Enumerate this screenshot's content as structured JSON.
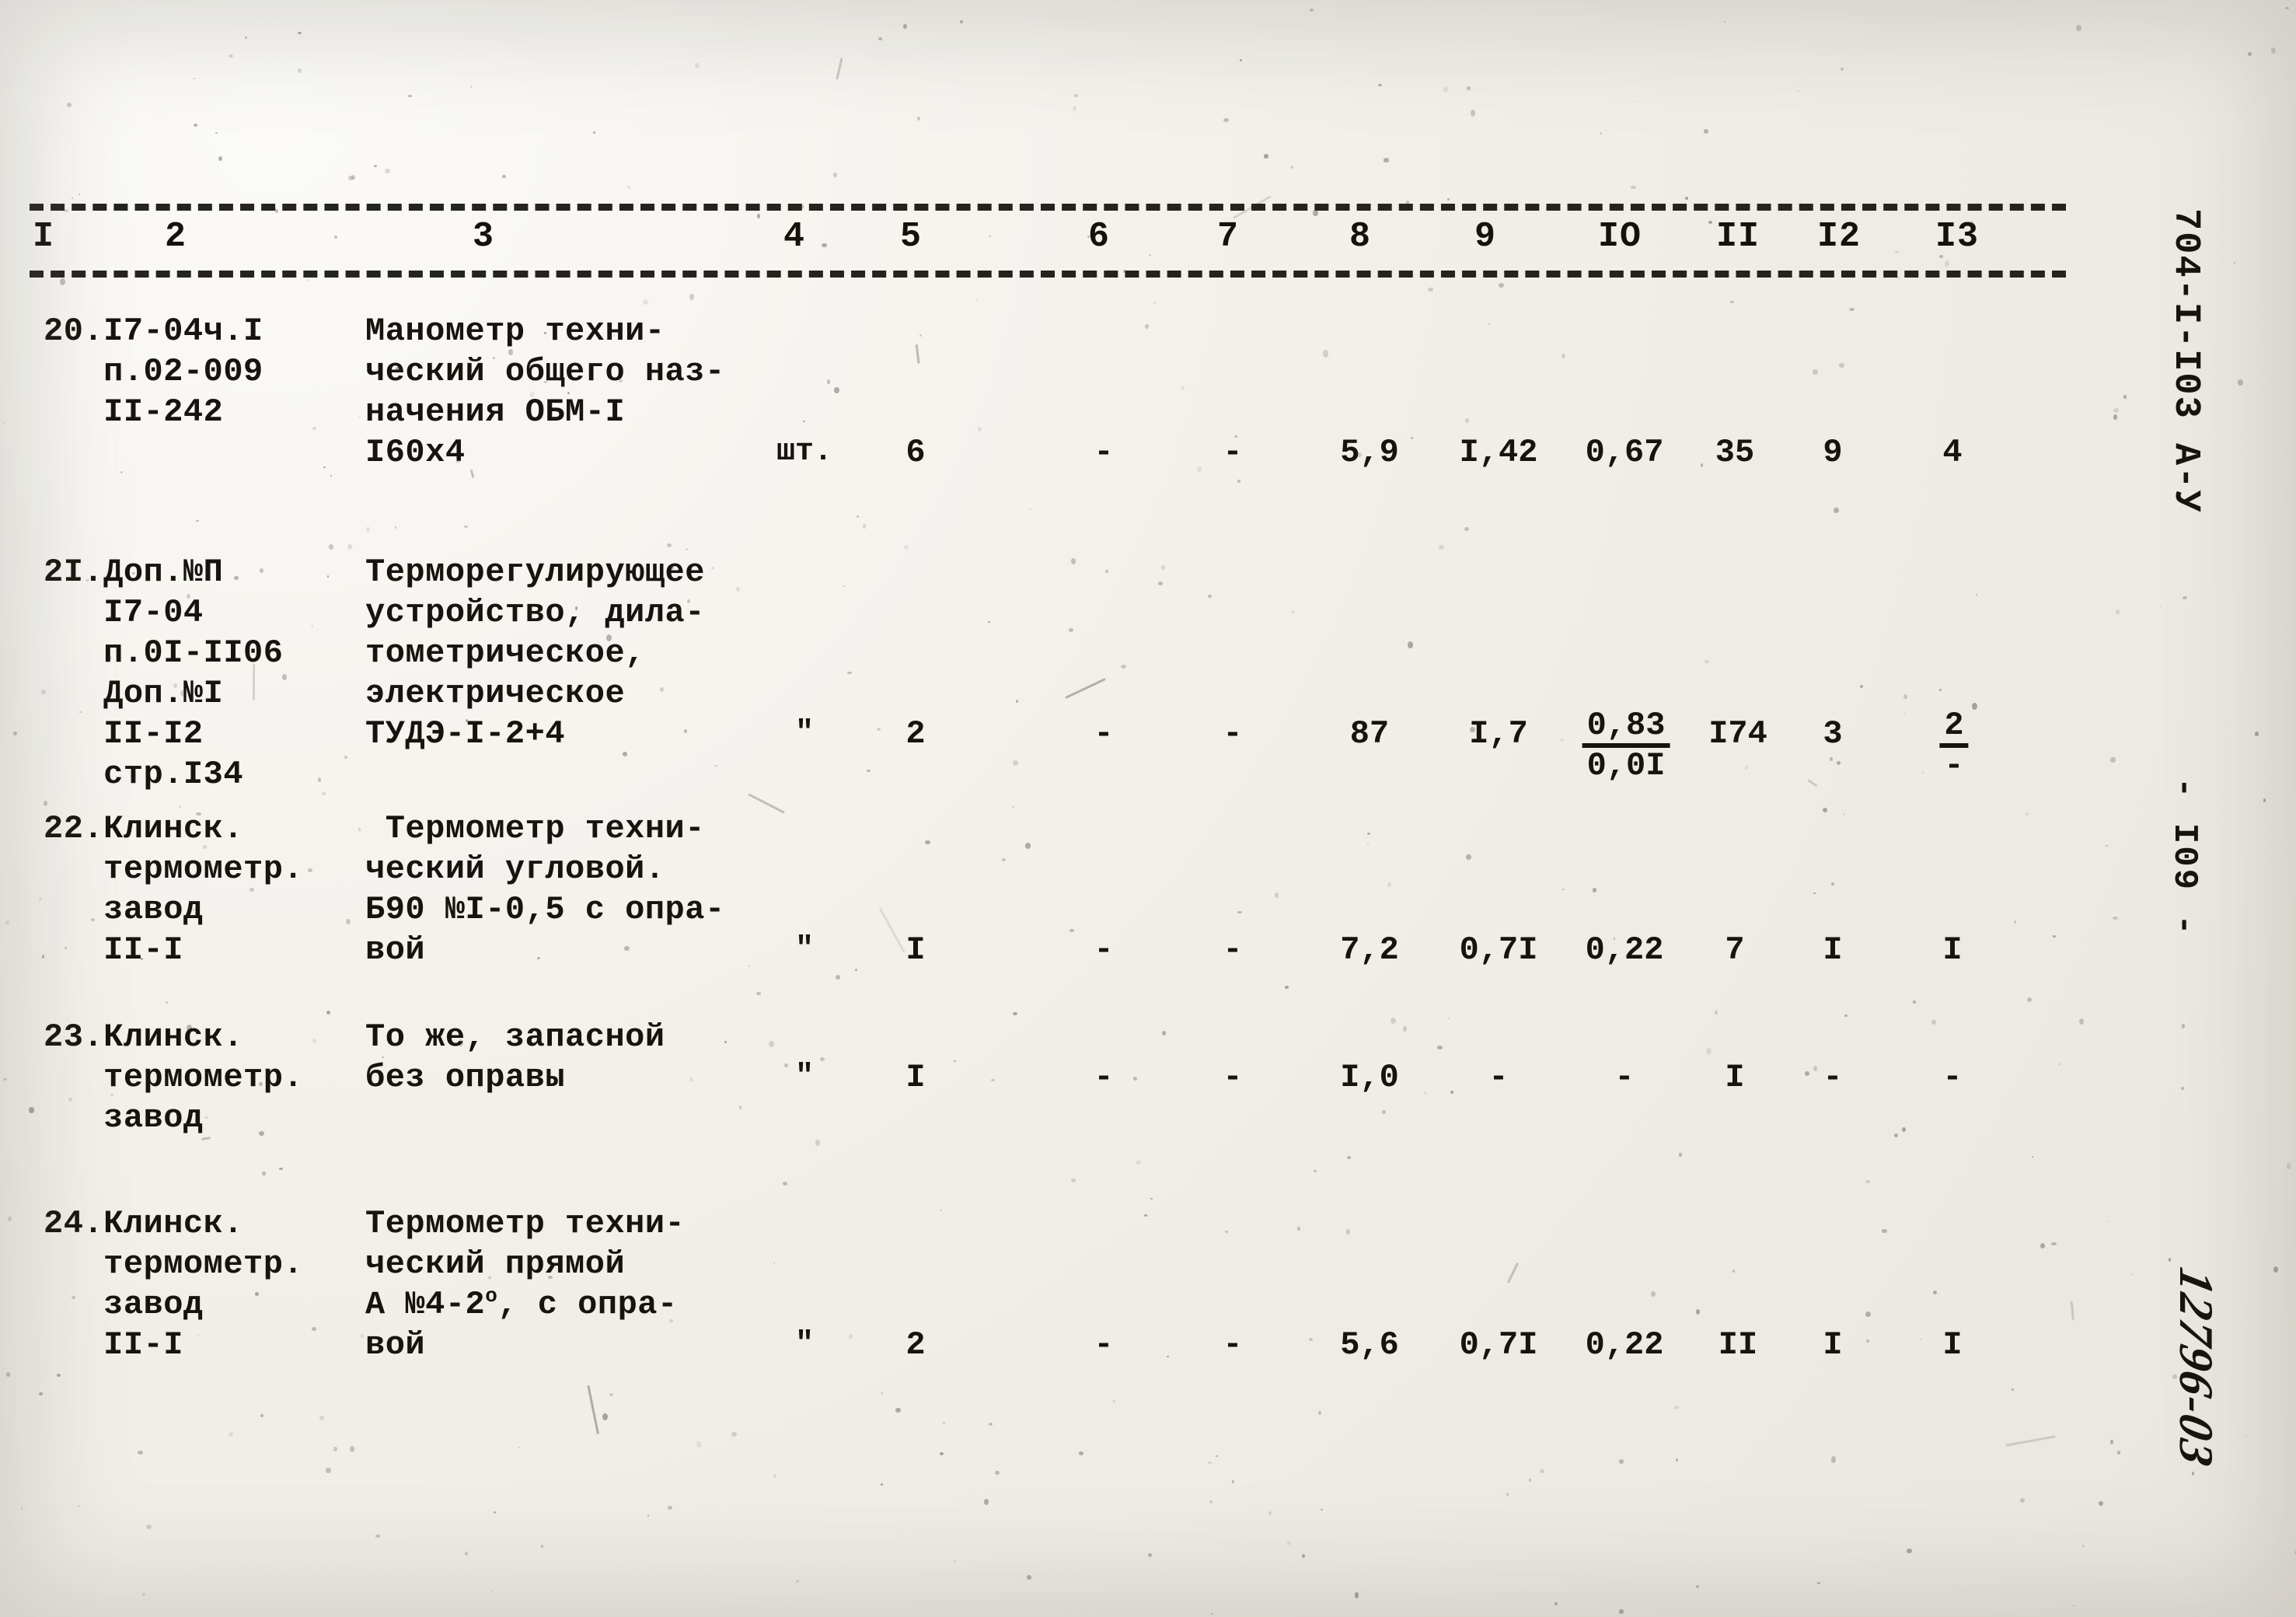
{
  "document": {
    "doc_code": "704-I-I03 А-У",
    "page_number": "- I09 -",
    "archive_number": "12796-03"
  },
  "table": {
    "column_headers": [
      "I",
      "2",
      "3",
      "4",
      "5",
      "6",
      "7",
      "8",
      "9",
      "IO",
      "II",
      "I2",
      "I3"
    ],
    "rows": [
      {
        "code_lines": [
          "20.I7-04ч.I",
          "   п.02-009",
          "   II-242"
        ],
        "desc_lines": [
          "Манометр техни-",
          "ческий общего наз-",
          "начения ОБМ-I",
          "I60х4"
        ],
        "unit": "шт.",
        "c5": "6",
        "c6": "-",
        "c7": "-",
        "c8": "5,9",
        "c9": "I,42",
        "c10": "0,67",
        "c11": "35",
        "c12": "9",
        "c13": "4"
      },
      {
        "code_lines": [
          "2I.Доп.№П",
          "   I7-04",
          "   п.0I-II06",
          "   Доп.№I",
          "   II-I2",
          "   стр.I34"
        ],
        "desc_lines": [
          "Терморегулирующее",
          "устройство, дила-",
          "тометрическое,",
          "электрическое",
          "ТУДЭ-I-2+4"
        ],
        "unit": "\"",
        "c5": "2",
        "c6": "-",
        "c7": "-",
        "c8": "87",
        "c9": "I,7",
        "c10_over": "0,83",
        "c10_under": "0,0I",
        "c11": "I74",
        "c12": "3",
        "c13_over": "2",
        "c13_under": "-"
      },
      {
        "code_lines": [
          "22.Клинск.",
          "   термометр.",
          "   завод",
          "   II-I"
        ],
        "desc_lines": [
          " Термометр техни-",
          "ческий угловой.",
          "Б90 №I-0,5 с опра-",
          "вой"
        ],
        "unit": "\"",
        "c5": "I",
        "c6": "-",
        "c7": "-",
        "c8": "7,2",
        "c9": "0,7I",
        "c10": "0,22",
        "c11": "7",
        "c12": "I",
        "c13": "I"
      },
      {
        "code_lines": [
          "23.Клинск.",
          "   термометр.",
          "   завод"
        ],
        "desc_lines": [
          "То же, запасной",
          "без оправы"
        ],
        "unit": "\"",
        "c5": "I",
        "c6": "-",
        "c7": "-",
        "c8": "I,0",
        "c9": "-",
        "c10": "-",
        "c11": "I",
        "c12": "-",
        "c13": "-"
      },
      {
        "code_lines": [
          "24.Клинск.",
          "   термометр.",
          "   завод",
          "   II-I"
        ],
        "desc_lines": [
          "Термометр техни-",
          "ческий прямой",
          "А №4-2°, с опра-",
          "вой"
        ],
        "unit": "\"",
        "c5": "2",
        "c6": "-",
        "c7": "-",
        "c8": "5,6",
        "c9": "0,7I",
        "c10": "0,22",
        "c11": "II",
        "c12": "I",
        "c13": "I"
      }
    ]
  }
}
